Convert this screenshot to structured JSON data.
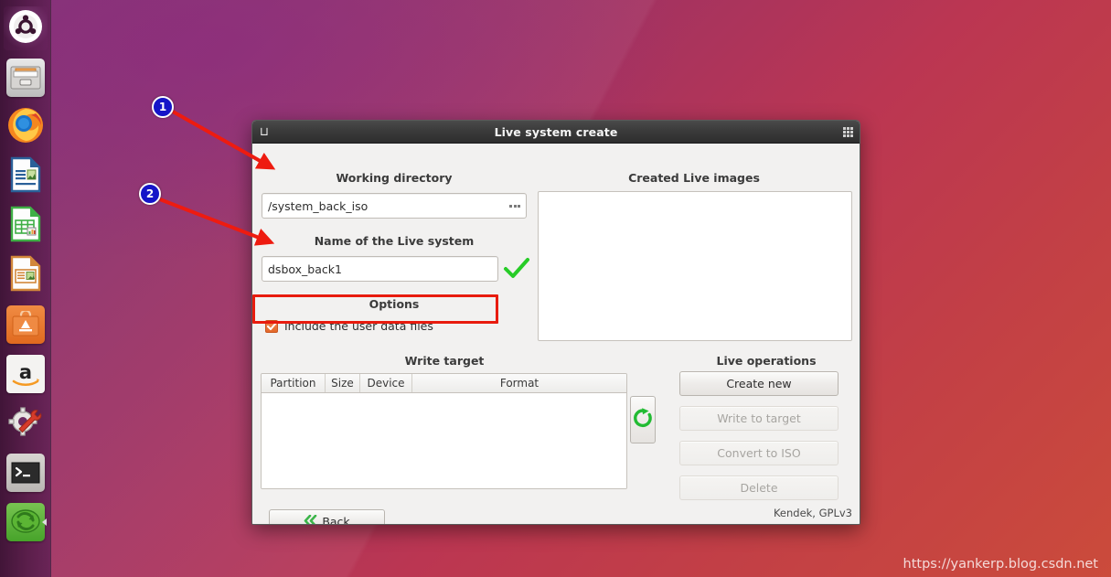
{
  "desktop": {
    "wallpaper_top_color": "#7b2a6e",
    "wallpaper_bottom_color": "#cb4b3b",
    "watermark": "https://yankerp.blog.csdn.net"
  },
  "launcher": {
    "items": [
      {
        "name": "ubuntu-dash-icon",
        "label": "Ubuntu Dash"
      },
      {
        "name": "files-icon",
        "label": "Files"
      },
      {
        "name": "firefox-icon",
        "label": "Firefox Web Browser"
      },
      {
        "name": "libreoffice-writer-icon",
        "label": "LibreOffice Writer"
      },
      {
        "name": "libreoffice-calc-icon",
        "label": "LibreOffice Calc"
      },
      {
        "name": "libreoffice-impress-icon",
        "label": "LibreOffice Impress"
      },
      {
        "name": "ubuntu-software-icon",
        "label": "Ubuntu Software"
      },
      {
        "name": "amazon-icon",
        "label": "Amazon"
      },
      {
        "name": "system-settings-icon",
        "label": "System Settings"
      },
      {
        "name": "terminal-icon",
        "label": "Terminal"
      },
      {
        "name": "systemback-icon",
        "label": "Systemback"
      }
    ]
  },
  "window": {
    "title": "Live system create",
    "titlebar_left_icon": "menu-glyph-icon",
    "titlebar_right_icon": "grip-dots-icon"
  },
  "working_directory": {
    "label": "Working directory",
    "value": "/system_back_iso",
    "browse_icon": "ellipsis-icon"
  },
  "live_system_name": {
    "label": "Name of the Live system",
    "value": "dsbox_back1",
    "valid_icon": "green-check-icon"
  },
  "options": {
    "label": "Options",
    "include_user_data": {
      "label": "Include the user data files",
      "checked": true,
      "checkbox_color": "#e4682a"
    }
  },
  "created_live_images": {
    "label": "Created Live images",
    "items": []
  },
  "write_target": {
    "label": "Write target",
    "columns": [
      "Partition",
      "Size",
      "Device",
      "Format"
    ],
    "rows": []
  },
  "refresh_button": {
    "name": "refresh-button",
    "icon": "refresh-icon",
    "icon_color": "#22bb33"
  },
  "live_operations": {
    "label": "Live operations",
    "buttons": [
      {
        "label": "Create new",
        "enabled": true
      },
      {
        "label": "Write to target",
        "enabled": false
      },
      {
        "label": "Convert to ISO",
        "enabled": false
      },
      {
        "label": "Delete",
        "enabled": false
      }
    ]
  },
  "back_button": {
    "label": "Back",
    "icon": "double-chevron-left-icon",
    "icon_color": "#3cb54a"
  },
  "credit": "Kendek, GPLv3",
  "annotations": {
    "color": "#ee1b10",
    "markers": [
      {
        "number": "1",
        "target": "working-directory-field"
      },
      {
        "number": "2",
        "target": "live-system-name-field"
      }
    ],
    "highlight_box": {
      "target": "include-user-data-checkbox",
      "color": "#e81b0e"
    }
  }
}
